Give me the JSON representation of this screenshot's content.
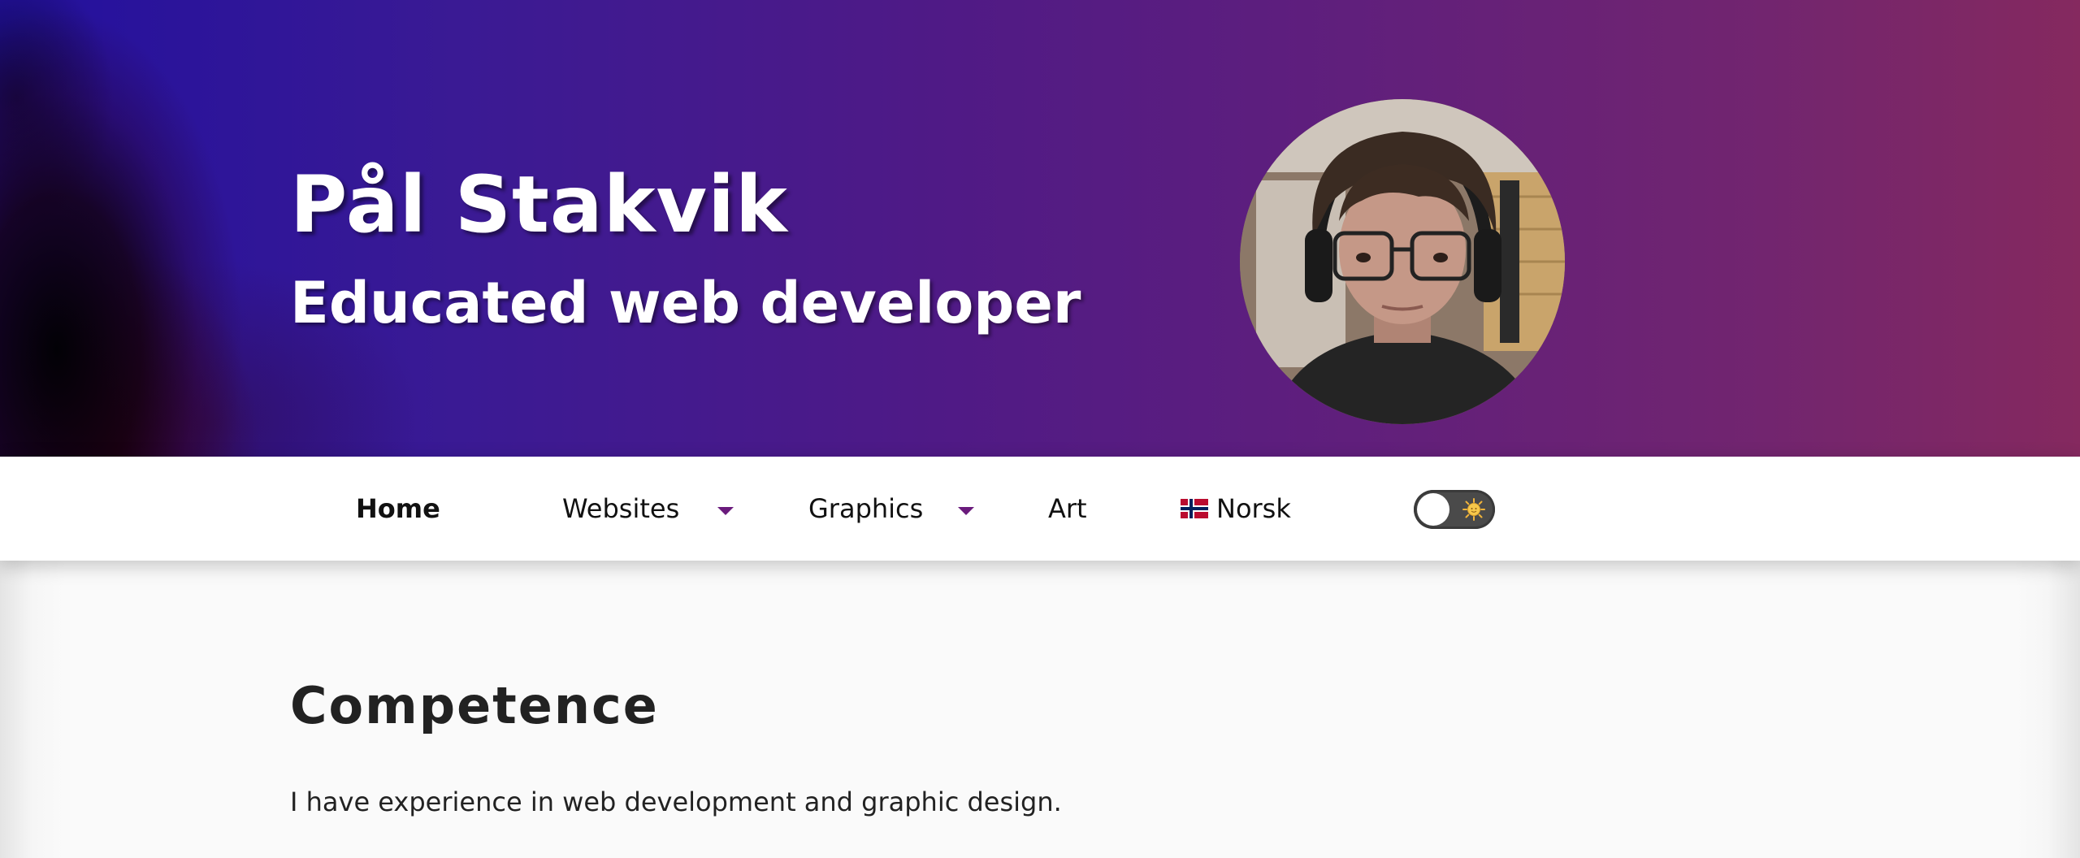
{
  "header": {
    "name": "Pål Stakvik",
    "tagline": "Educated web developer",
    "gradient_colors": [
      "#22109e",
      "#4f1a86",
      "#85295f"
    ]
  },
  "nav": {
    "items": [
      {
        "label": "Home",
        "active": true,
        "has_dropdown": false
      },
      {
        "label": "Websites",
        "active": false,
        "has_dropdown": true
      },
      {
        "label": "Graphics",
        "active": false,
        "has_dropdown": true
      },
      {
        "label": "Art",
        "active": false,
        "has_dropdown": false
      }
    ],
    "language": {
      "label": "Norsk",
      "icon": "norway-flag-icon"
    },
    "theme_toggle": {
      "state": "light",
      "icon": "sun-icon"
    },
    "accent_color": "#6a1b7c"
  },
  "main": {
    "section_title": "Competence",
    "section_text": "I have experience in web development and graphic design."
  }
}
